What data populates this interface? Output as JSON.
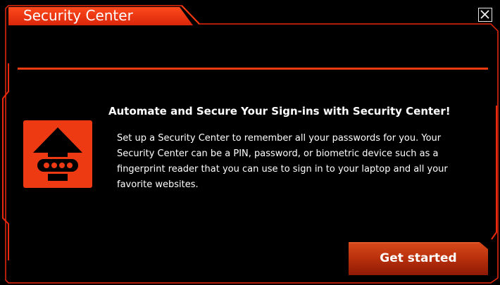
{
  "window": {
    "title": "Security Center"
  },
  "dialog": {
    "headline": "Automate and Secure Your Sign-ins with Security Center!",
    "body_lines": [
      "Set up a Security Center to remember all your passwords for you. Your",
      "Security Center can be a PIN, password, or biometric device such as a",
      "fingerprint reader that you can use to sign in to your laptop and all your",
      "favorite websites."
    ],
    "primary_button_label": "Get started"
  },
  "icons": {
    "close": "close-icon",
    "app": "upload-arrow-icon"
  },
  "colors": {
    "accent": "#ee3a12",
    "border": "#e8290d",
    "background": "#000000",
    "text": "#ffffff",
    "button_top": "#d94a1a",
    "button_bottom": "#8e1a05"
  }
}
